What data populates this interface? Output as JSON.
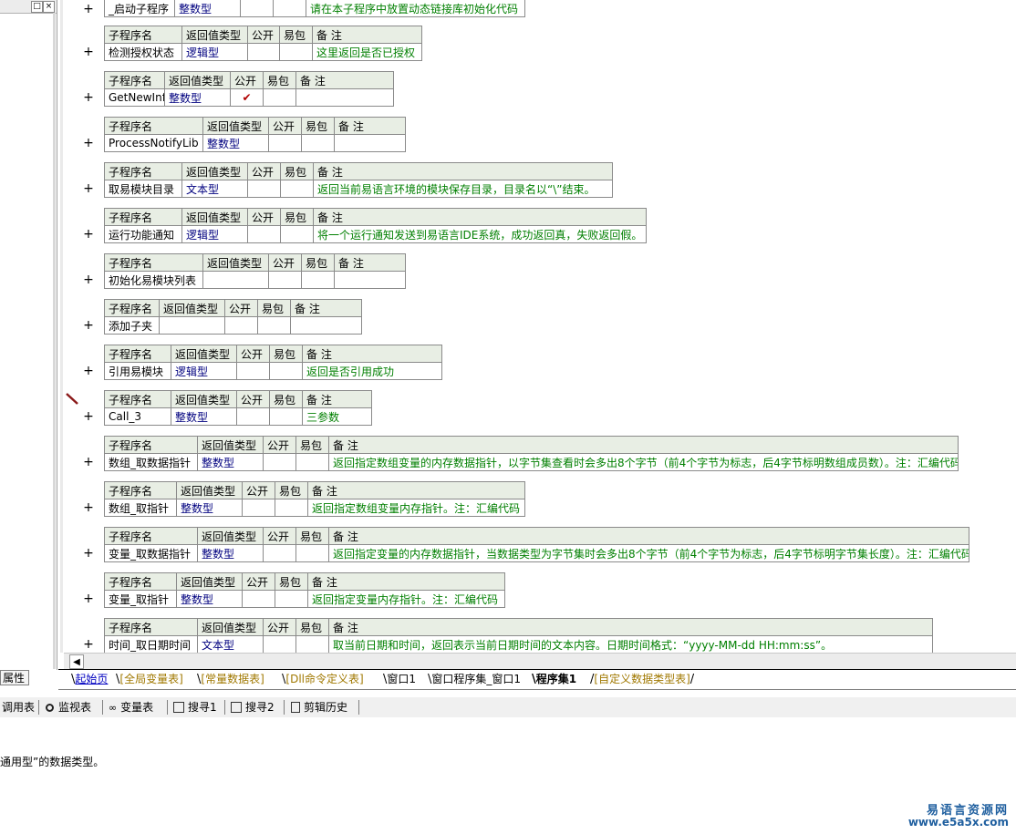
{
  "left_panel": {
    "tab_label": "属性"
  },
  "headers": {
    "name": "子程序名",
    "ret": "返回值类型",
    "public": "公开",
    "easy": "易包",
    "note": "备 注"
  },
  "top_row": {
    "name": "_启动子程序",
    "type": "整数型",
    "note": "请在本子程序中放置动态链接库初始化代码"
  },
  "subs": [
    {
      "name": "检测授权状态",
      "type": "逻辑型",
      "public": "",
      "note": "这里返回是否已授权"
    },
    {
      "name": "GetNewInf",
      "type": "整数型",
      "public": "✔",
      "note": ""
    },
    {
      "name": "ProcessNotifyLib",
      "type": "整数型",
      "public": "",
      "note": ""
    },
    {
      "name": "取易模块目录",
      "type": "文本型",
      "public": "",
      "note": "返回当前易语言环境的模块保存目录，目录名以“\\”结束。"
    },
    {
      "name": "运行功能通知",
      "type": "逻辑型",
      "public": "",
      "note": "将一个运行通知发送到易语言IDE系统，成功返回真，失败返回假。"
    },
    {
      "name": "初始化易模块列表",
      "type": "",
      "public": "",
      "note": ""
    },
    {
      "name": "添加子夹",
      "type": "",
      "public": "",
      "note": ""
    },
    {
      "name": "引用易模块",
      "type": "逻辑型",
      "public": "",
      "note": "返回是否引用成功"
    },
    {
      "name": "Call_3",
      "type": "整数型",
      "public": "",
      "note": "三参数"
    },
    {
      "name": "数组_取数据指针",
      "type": "整数型",
      "public": "",
      "note": "返回指定数组变量的内存数据指针，以字节集查看时会多出8个字节（前4个字节为标志，后4字节标明数组成员数）。注：汇编代码"
    },
    {
      "name": "数组_取指针",
      "type": "整数型",
      "public": "",
      "note": "返回指定数组变量内存指针。注：汇编代码"
    },
    {
      "name": "变量_取数据指针",
      "type": "整数型",
      "public": "",
      "note": "返回指定变量的内存数据指针，当数据类型为字节集时会多出8个字节（前4个字节为标志，后4字节标明字节集长度）。注：汇编代码"
    },
    {
      "name": "变量_取指针",
      "type": "整数型",
      "public": "",
      "note": "返回指定变量内存指针。注：汇编代码"
    },
    {
      "name": "时间_取日期时间",
      "type": "文本型",
      "public": "",
      "note": "取当前日期和时间，返回表示当前日期时间的文本内容。日期时间格式：“yyyy-MM-dd HH:mm:ss”。"
    }
  ],
  "tabs": [
    "起始页",
    "[全局变量表]",
    "[常量数据表]",
    "[Dll命令定义表]",
    "窗口1",
    "窗口程序集_窗口1",
    "程序集1",
    "[自定义数据类型表]"
  ],
  "toolbar": {
    "call_table": "调用表",
    "watch": "监视表",
    "vars": "变量表",
    "search1": "搜寻1",
    "search2": "搜寻2",
    "clip_history": "剪辑历史"
  },
  "output_text": "通用型”的数据类型。",
  "watermark": {
    "name": "易语言资源网",
    "url": "www.e5a5x.com"
  },
  "colors": {
    "type_text": "#00007f",
    "comment_text": "#007f00",
    "header_bg": "#e8eee4",
    "tab_blue": "#0000c0",
    "tab_gold": "#a07800",
    "watermark": "#1f5f9f"
  }
}
